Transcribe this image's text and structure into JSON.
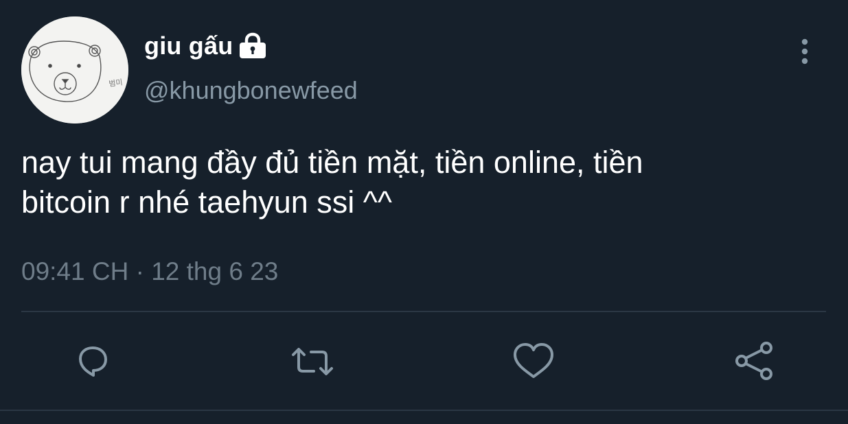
{
  "tweet": {
    "display_name": "giu gấu",
    "handle": "@khungbonewfeed",
    "text_line_1": "nay tui mang đầy đủ tiền mặt, tiền online, tiền",
    "text_line_2": "bitcoin r nhé taehyun ssi ^^",
    "time": "09:41 CH",
    "separator": "·",
    "date": "12 thg 6 23"
  },
  "avatar": {
    "sketch_text": "범미"
  },
  "icons": {
    "lock": "lock-icon",
    "more": "more-vertical-icon",
    "reply": "reply-icon",
    "retweet": "retweet-icon",
    "like": "heart-icon",
    "share": "share-icon"
  },
  "colors": {
    "background": "#16202b",
    "text_primary": "#ffffff",
    "text_secondary": "#8899a6",
    "icon": "#8899a6",
    "divider": "#2b3744"
  }
}
